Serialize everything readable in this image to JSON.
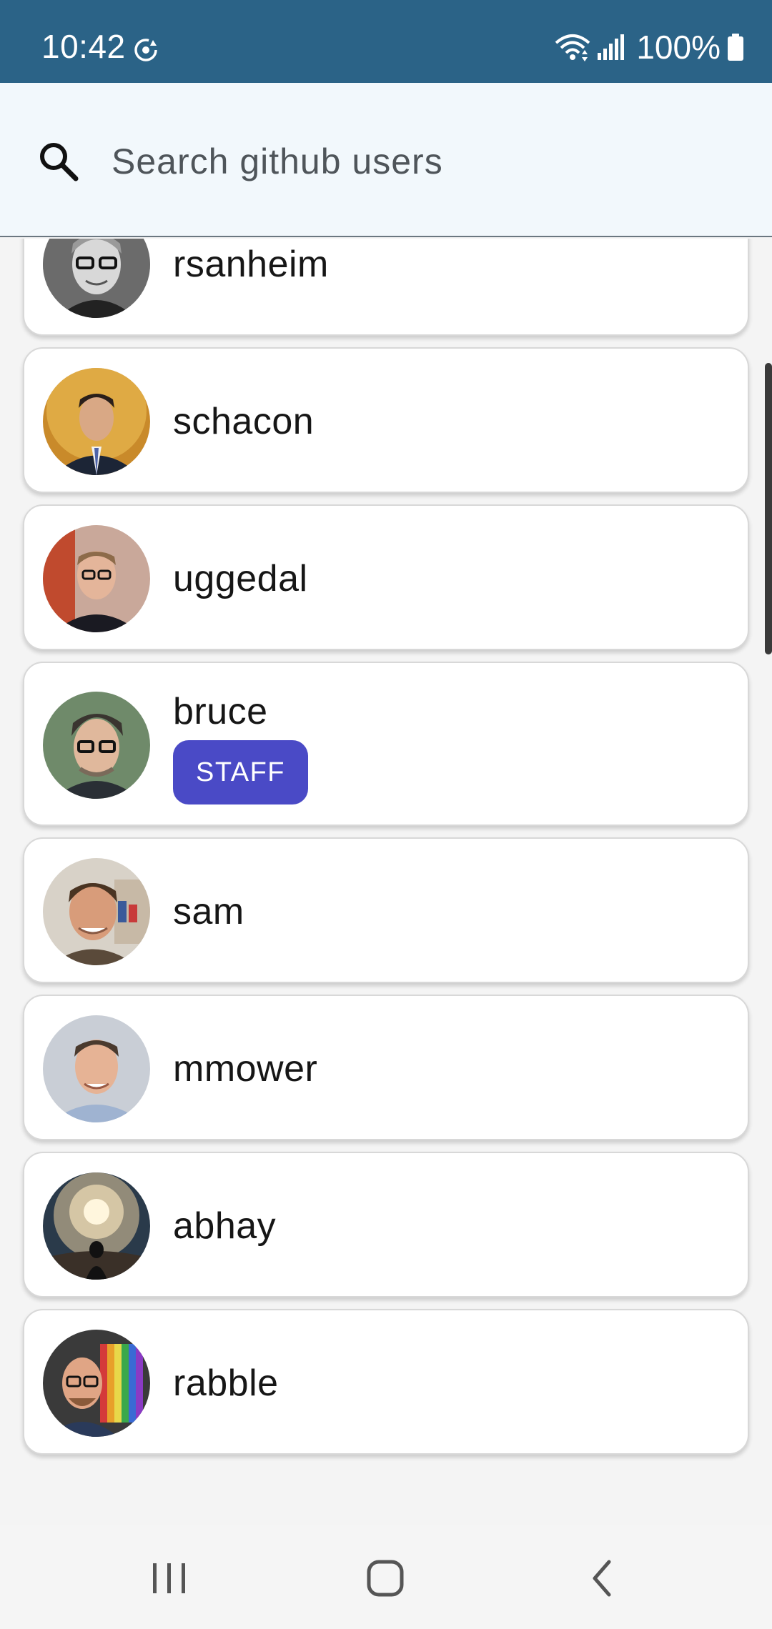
{
  "status_bar": {
    "time": "10:42",
    "battery": "100%",
    "icons": [
      "sync-icon",
      "wifi-icon",
      "signal-icon",
      "battery-icon"
    ],
    "background": "#2b6387"
  },
  "search": {
    "placeholder": "Search github users",
    "value": "",
    "icon": "search-icon"
  },
  "users": [
    {
      "login": "rsanheim",
      "staff": false
    },
    {
      "login": "schacon",
      "staff": false
    },
    {
      "login": "uggedal",
      "staff": false
    },
    {
      "login": "bruce",
      "staff": true,
      "badge": "STAFF"
    },
    {
      "login": "sam",
      "staff": false
    },
    {
      "login": "mmower",
      "staff": false
    },
    {
      "login": "abhay",
      "staff": false
    },
    {
      "login": "rabble",
      "staff": false
    }
  ],
  "colors": {
    "badge": "#4a4ac6",
    "search_background": "#f2f8fc",
    "card_background": "#ffffff"
  },
  "nav_bar": {
    "buttons": [
      "recents-icon",
      "home-icon",
      "back-icon"
    ]
  }
}
